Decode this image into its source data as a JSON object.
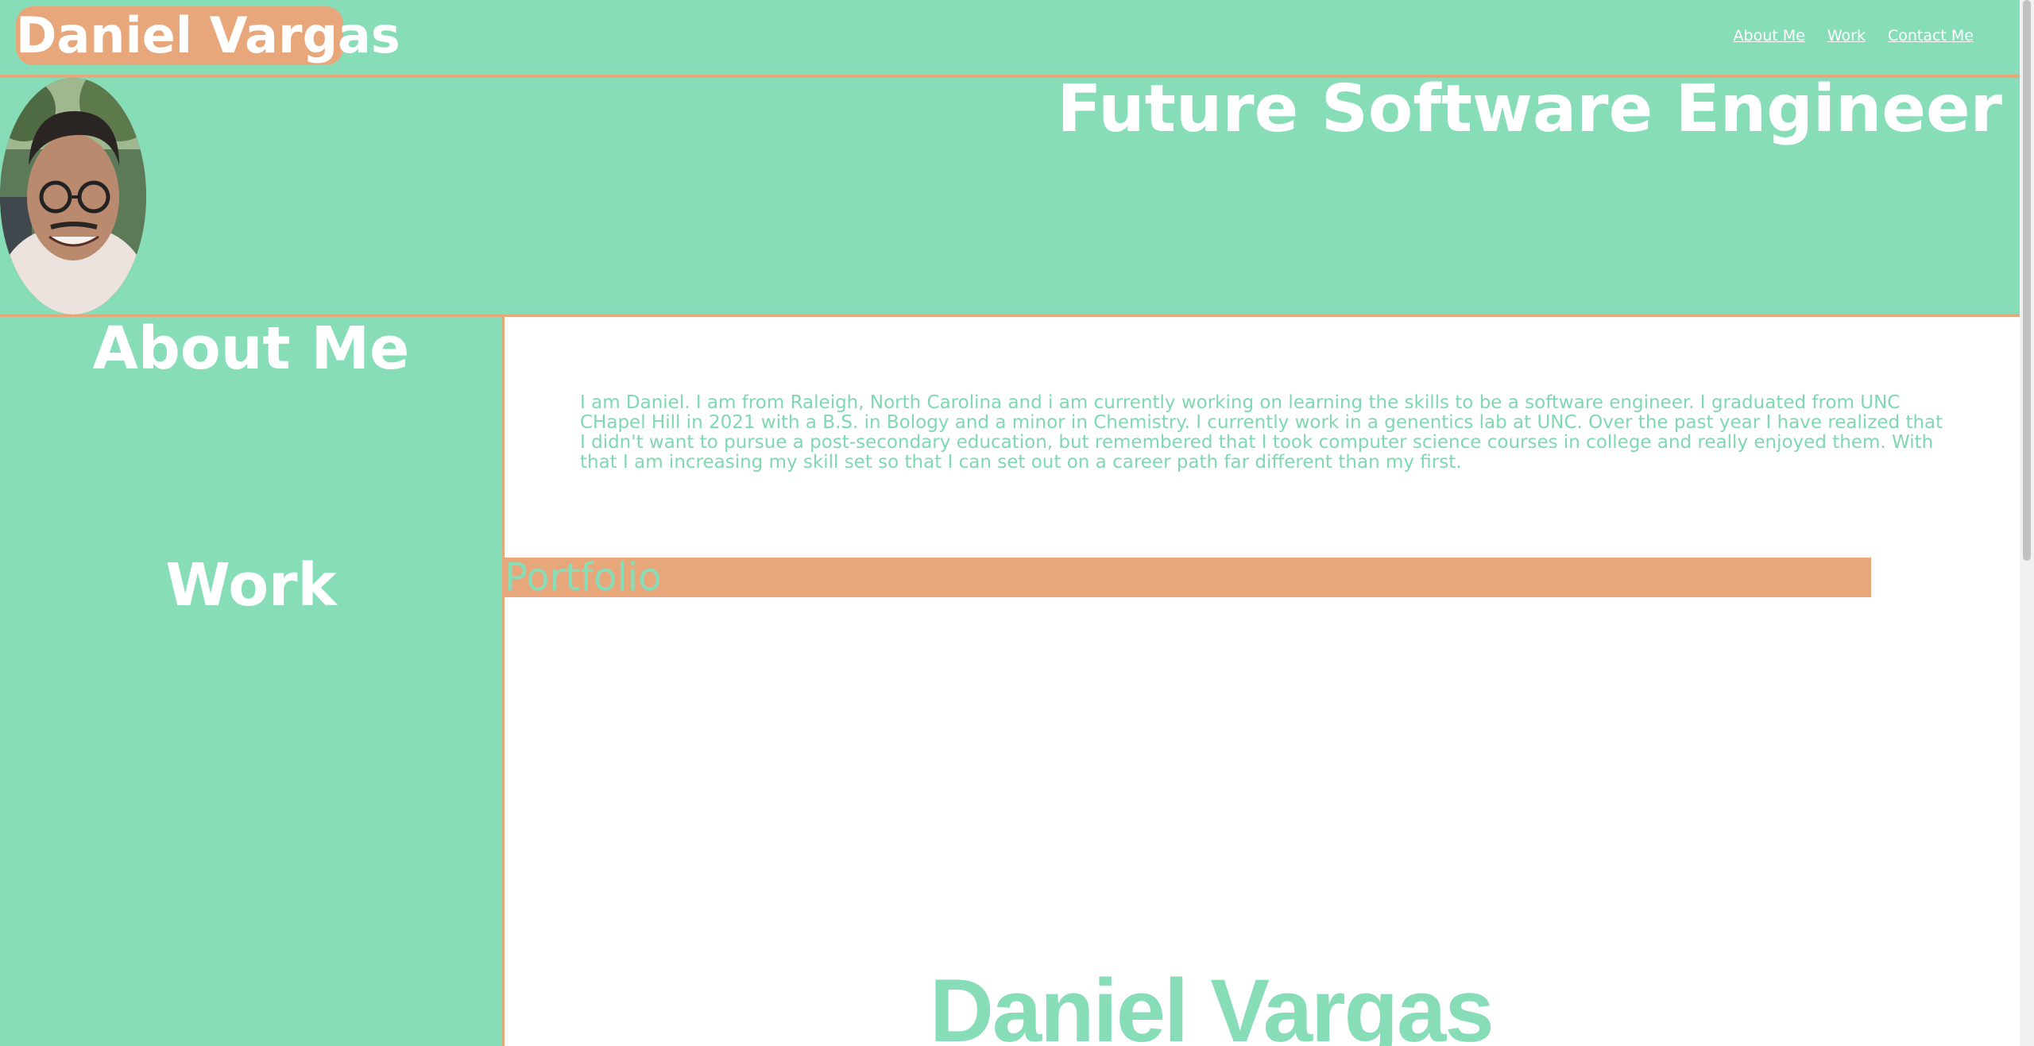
{
  "header": {
    "brand": "Daniel Vargas",
    "nav": [
      {
        "label": "About Me"
      },
      {
        "label": "Work"
      },
      {
        "label": "Contact Me"
      }
    ]
  },
  "hero": {
    "tagline": "Future Software Engineer",
    "avatar_alt": "profile-photo"
  },
  "sidebar": {
    "about_heading": "About Me",
    "work_heading": "Work"
  },
  "main": {
    "about_text": "I am Daniel. I am from Raleigh, North Carolina and i am currently working on learning the skills to be a software engineer. I graduated from UNC CHapel Hill in 2021 with a B.S. in Bology and a minor in Chemistry. I currently work in a genentics lab at UNC. Over the past year I have realized that I didn't want to pursue a post-secondary education, but remembered that I took computer science courses in college and really enjoyed them. With that I am increasing my skill set so that I can set out on a career path far different than my first.",
    "portfolio_label": "Portfolio",
    "footer_logo": "Daniel Vargas"
  },
  "colors": {
    "mint": "#87ddb8",
    "peach": "#e8a77b",
    "white": "#ffffff"
  }
}
